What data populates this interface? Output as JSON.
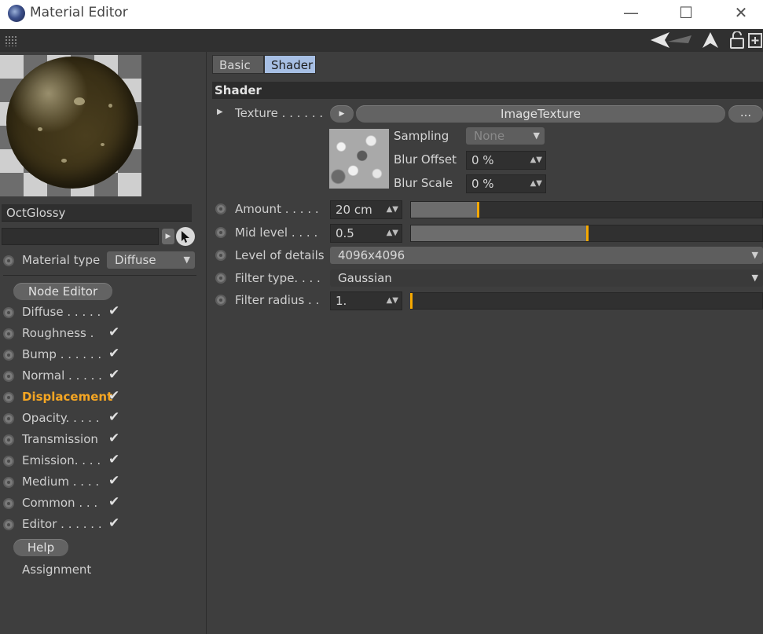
{
  "window": {
    "title": "Material Editor",
    "minimize": "—",
    "maximize": "☐",
    "close": "✕"
  },
  "toolbar": {
    "icons": [
      "back-arrow-icon",
      "navigate-arrow-icon",
      "lock-icon",
      "new-window-icon"
    ]
  },
  "left": {
    "material_name": "OctGlossy",
    "search_value": "",
    "material_type_label": "Material type",
    "material_type_value": "Diffuse",
    "node_editor_label": "Node Editor",
    "channels": [
      {
        "label": "Diffuse . . . . .",
        "checked": true
      },
      {
        "label": "Roughness  .",
        "checked": true
      },
      {
        "label": "Bump . . . . . .",
        "checked": true
      },
      {
        "label": "Normal . . . . .",
        "checked": true
      },
      {
        "label": "Displacement",
        "checked": true,
        "active": true
      },
      {
        "label": "Opacity. . . . .",
        "checked": true
      },
      {
        "label": "Transmission",
        "checked": true
      },
      {
        "label": "Emission. . . .",
        "checked": true
      },
      {
        "label": "Medium . . . .",
        "checked": true
      },
      {
        "label": "Common  . . .",
        "checked": true
      },
      {
        "label": "Editor . . . . . .",
        "checked": true
      }
    ],
    "help_label": "Help",
    "assignment_label": "Assignment"
  },
  "right": {
    "tabs": [
      {
        "label": "Basic",
        "active": false
      },
      {
        "label": "Shader",
        "active": true
      }
    ],
    "section_title": "Shader",
    "texture": {
      "label": "Texture . . . . . .",
      "value": "ImageTexture",
      "more": "...",
      "sampling_label": "Sampling",
      "sampling_value": "None",
      "blur_offset_label": "Blur Offset",
      "blur_offset_value": "0 %",
      "blur_scale_label": "Blur Scale",
      "blur_scale_value": "0 %"
    },
    "amount": {
      "label": "Amount . . . . .",
      "value": "20 cm",
      "slider_fraction": 0.19
    },
    "mid_level": {
      "label": "Mid level  . . . .",
      "value": "0.5",
      "slider_fraction": 0.5
    },
    "level_of_details": {
      "label": "Level of details",
      "value": "4096x4096"
    },
    "filter_type": {
      "label": "Filter type. . . .",
      "value": "Gaussian"
    },
    "filter_radius": {
      "label": "Filter radius . .",
      "value": "1.",
      "slider_fraction": 0.0
    }
  },
  "colors": {
    "accent_active": "#f5a623",
    "slider_marker": "#f5a800",
    "tab_active": "#a7bfe4"
  }
}
